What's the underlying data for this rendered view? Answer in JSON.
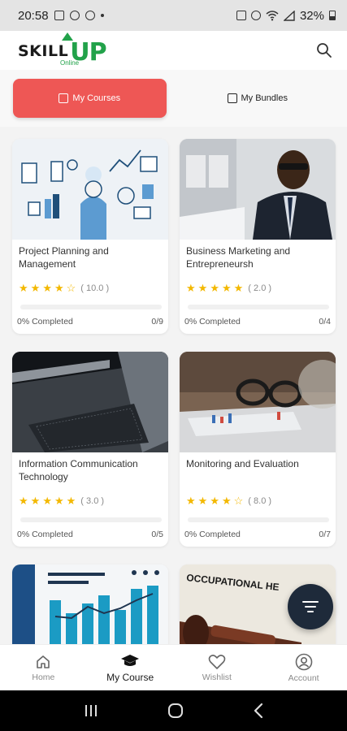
{
  "status_bar": {
    "time": "20:58",
    "battery": "32%"
  },
  "app": {
    "logo_skill": "SKILL",
    "logo_up": "UP",
    "logo_online": "Online"
  },
  "tabs": [
    {
      "label": "My Courses",
      "active": true
    },
    {
      "label": "My Bundles",
      "active": false
    }
  ],
  "courses": [
    {
      "title": "Project Planning and Management",
      "rating": "10.0",
      "stars": 4,
      "completed": "0% Completed",
      "lessons": "0/9",
      "progress": 0
    },
    {
      "title": "Business Marketing and Entrepreneursh",
      "rating": "2.0",
      "stars": 5,
      "completed": "0% Completed",
      "lessons": "0/4",
      "progress": 0
    },
    {
      "title": "Information Communication Technology",
      "rating": "3.0",
      "stars": 5,
      "completed": "0% Completed",
      "lessons": "0/5",
      "progress": 0
    },
    {
      "title": "Monitoring and Evaluation",
      "rating": "8.0",
      "stars": 4,
      "completed": "0% Completed",
      "lessons": "0/7",
      "progress": 0
    }
  ],
  "partial_cards": {
    "right_image_text": "OCCUPATIONAL HE"
  },
  "bottom_nav": [
    {
      "label": "Home",
      "icon": "home-icon",
      "active": false
    },
    {
      "label": "My Course",
      "icon": "graduation-cap-icon",
      "active": true
    },
    {
      "label": "Wishlist",
      "icon": "heart-icon",
      "active": false
    },
    {
      "label": "Account",
      "icon": "account-icon",
      "active": false
    }
  ],
  "colors": {
    "accent": "#ee5755",
    "brand_green": "#22a24a",
    "star": "#f3b800",
    "fab": "#1e2a3a"
  }
}
